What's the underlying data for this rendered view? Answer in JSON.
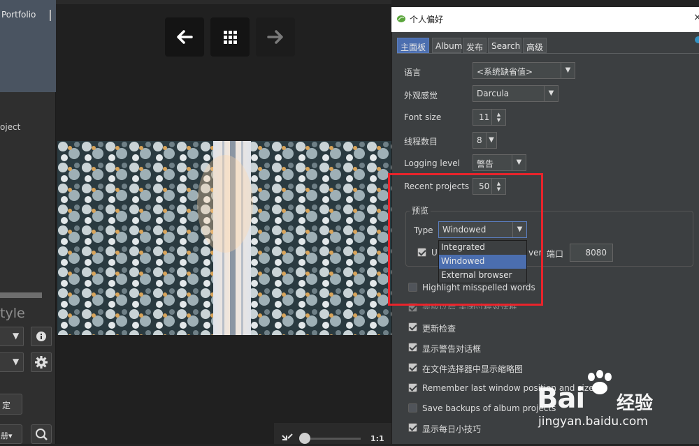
{
  "left_panel": {
    "title": "Portfolio",
    "project_label": "oject",
    "style_label": "tyle",
    "apply_label": "定",
    "album_select": "册▾"
  },
  "viewer": {
    "nav": [
      "back-arrow-icon",
      "grid-icon",
      "forward-arrow-icon"
    ],
    "zoom_fit_label": "1:1"
  },
  "dialog": {
    "title": "个人偏好",
    "close": "×",
    "tabs": [
      "主面板",
      "Album",
      "发布",
      "Search",
      "高级"
    ],
    "active_tab": "主面板",
    "fields": {
      "language": {
        "label": "语言",
        "value": "<系统缺省值>"
      },
      "look_feel": {
        "label": "外观感觉",
        "value": "Darcula"
      },
      "font_size": {
        "label": "Font size",
        "value": "11"
      },
      "threads": {
        "label": "线程数目",
        "value": "8"
      },
      "logging": {
        "label": "Logging level",
        "value": "警告"
      },
      "recent": {
        "label": "Recent projects",
        "value": "50"
      }
    },
    "preview": {
      "legend": "预览",
      "type_label": "Type",
      "type_value": "Windowed",
      "use_server_partial_left": "U",
      "use_server_partial_right": "ver",
      "port_label": "端口",
      "port_value": "8080",
      "options": [
        "Integrated",
        "Windowed",
        "External browser"
      ],
      "selected_option": "Windowed"
    },
    "checkboxes": [
      {
        "label": "Highlight misspelled words",
        "checked": false
      },
      {
        "label": "完成以后,关闭过程对话框",
        "checked": true
      },
      {
        "label": "更新检查",
        "checked": true
      },
      {
        "label": "显示警告对话框",
        "checked": true
      },
      {
        "label": "在文件选择器中显示缩略图",
        "checked": true
      },
      {
        "label": "Remember last window position and size",
        "checked": true
      },
      {
        "label": "Save backups of album projects",
        "checked": false
      },
      {
        "label": "显示每日小技巧",
        "checked": true
      }
    ]
  },
  "watermark": {
    "brand": "Bai",
    "brand_cn": "经验",
    "url": "jingyan.baidu.com"
  },
  "colors": {
    "accent": "#4b6eaf",
    "highlight_box": "#e8242b",
    "dialog_bg": "#3c3f41"
  }
}
